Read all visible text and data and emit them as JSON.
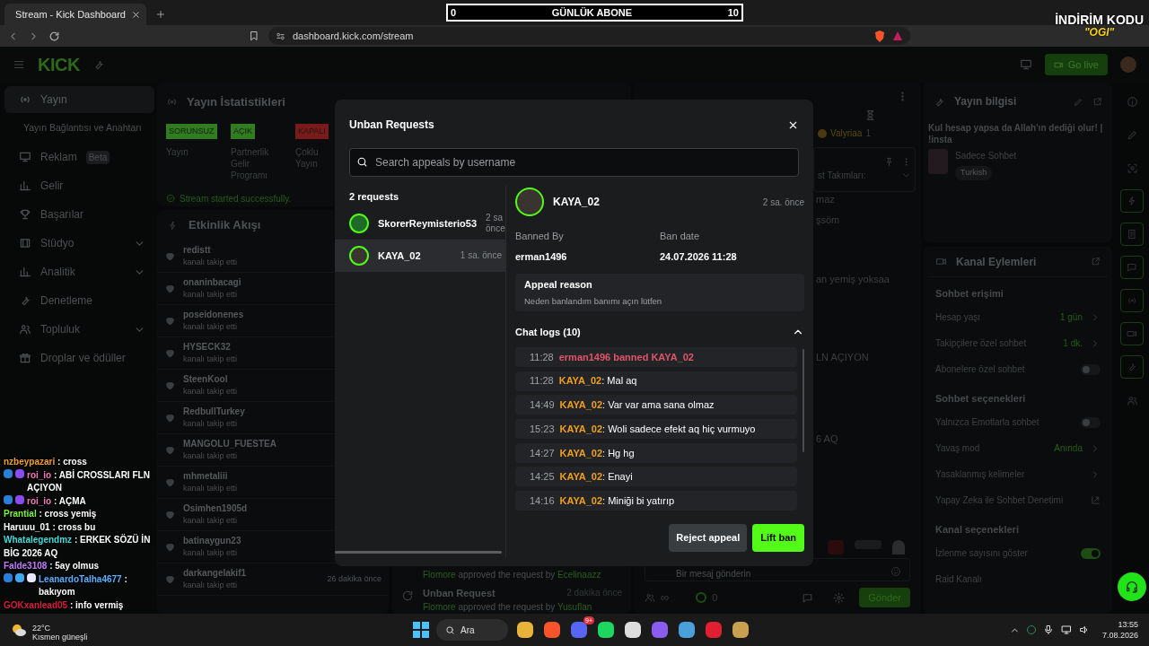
{
  "browser": {
    "tab_title": "Stream - Kick Dashboard",
    "url": "dashboard.kick.com/stream"
  },
  "stream_overlays": {
    "goal": {
      "start": "0",
      "label": "GÜNLÜK ABONE",
      "end": "10"
    },
    "promo": {
      "title": "İNDİRİM KODU",
      "code": "\"OGI\""
    }
  },
  "header": {
    "logo": "KICK",
    "go_live": "Go live"
  },
  "sidebar": {
    "items": [
      {
        "kind": "main",
        "label": "Yayın",
        "selected": true,
        "expandable": false
      },
      {
        "kind": "sub",
        "label": "Yayın Bağlantısı ve Anahtarı",
        "selected": false
      },
      {
        "kind": "main",
        "label": "Reklam",
        "badge": "Beta",
        "selected": false,
        "expandable": false
      },
      {
        "kind": "main",
        "label": "Gelir",
        "selected": false,
        "expandable": false
      },
      {
        "kind": "main",
        "label": "Başarılar",
        "selected": false,
        "expandable": false
      },
      {
        "kind": "main",
        "label": "Stüdyo",
        "selected": false,
        "expandable": true
      },
      {
        "kind": "main",
        "label": "Analitik",
        "selected": false,
        "expandable": true
      },
      {
        "kind": "main",
        "label": "Denetleme",
        "selected": false,
        "expandable": false
      },
      {
        "kind": "main",
        "label": "Topluluk",
        "selected": false,
        "expandable": true
      },
      {
        "kind": "main",
        "label": "Droplar ve ödüller",
        "selected": false,
        "expandable": false
      }
    ]
  },
  "stats": {
    "title": "Yayın İstatistikleri",
    "items": [
      {
        "badge": "SORUNSUZ",
        "color": "#2f7d1f",
        "label": "Yayın"
      },
      {
        "badge": "AÇIK",
        "color": "#2f7d1f",
        "label": "Partnerlik Gelir Programı"
      },
      {
        "badge": "KAPALI",
        "color": "#7a1a1a",
        "label": "Çoklu Yayın"
      }
    ],
    "notice": "Stream started successfully."
  },
  "feed": {
    "title": "Etkinlik Akışı",
    "events": [
      {
        "user": "redistt",
        "action": "kanalı takip etti"
      },
      {
        "user": "onaninbacagi",
        "action": "kanalı takip etti"
      },
      {
        "user": "poseidonenes",
        "action": "kanalı takip etti"
      },
      {
        "user": "HYSECK32",
        "action": "kanalı takip etti"
      },
      {
        "user": "SteenKool",
        "action": "kanalı takip etti"
      },
      {
        "user": "RedbullTurkey",
        "action": "kanalı takip etti"
      },
      {
        "user": "MANGOLU_FUESTEA",
        "action": "kanalı takip etti"
      },
      {
        "user": "mhmetaliii",
        "action": "kanalı takip etti"
      },
      {
        "user": "Osimhen1905d",
        "action": "kanalı takip etti"
      },
      {
        "user": "batinaygun23",
        "action": "kanalı takip etti"
      },
      {
        "user": "darkangelakif1",
        "action": "kanalı takip etti",
        "time": "26 dakika önce"
      }
    ]
  },
  "mod_log": {
    "entries": [
      {
        "actor": "Flomore",
        "action": "approved the request by",
        "target": "Ecelinaazz"
      },
      {
        "title": "Unban Request",
        "time": "2 dakika önce",
        "actor": "Flomore",
        "action": "approved the request by",
        "target": "Yusuflan"
      }
    ]
  },
  "chat": {
    "badged_user": "Valyriaa",
    "badged_user_count": "1",
    "pinned": "st Takımları:",
    "fragments": [
      "maz",
      "şsöm",
      "an yemiş yoksaa",
      "LN AÇIYON",
      "6 AQ"
    ],
    "input": {
      "placeholder": "Bir mesaj gönderin"
    },
    "infinity": "∞",
    "coins": "0",
    "send": "Gönder"
  },
  "stream_info": {
    "title": "Yayın bilgisi",
    "stream_title": "Kul hesap yapsa da Allah'ın dediği olur! | !insta",
    "category": "Sadece Sohbet",
    "tag": "Turkish"
  },
  "channel_actions": {
    "title": "Kanal Eylemleri",
    "rows": [
      {
        "kind": "section",
        "label": "Sohbet erişimi"
      },
      {
        "kind": "value",
        "label": "Hesap yaşı",
        "value": "1 gün"
      },
      {
        "kind": "value",
        "label": "Takipçilere özel sohbet",
        "value": "1 dk."
      },
      {
        "kind": "toggle",
        "label": "Abonelere özel sohbet",
        "on": false
      },
      {
        "kind": "section",
        "label": "Sohbet seçenekleri"
      },
      {
        "kind": "toggle",
        "label": "Yalnızca Emotlarla sohbet",
        "on": false
      },
      {
        "kind": "value",
        "label": "Yavaş mod",
        "value": "Anında"
      },
      {
        "kind": "link",
        "label": "Yasaklanmış kelimeler"
      },
      {
        "kind": "external",
        "label": "Yapay Zeka ile Sohbet Denetimi"
      },
      {
        "kind": "section",
        "label": "Kanal seçenekleri"
      },
      {
        "kind": "toggle",
        "label": "İzlenme sayısını göster",
        "on": true
      },
      {
        "kind": "plain",
        "label": "Raid Kanalı"
      }
    ]
  },
  "overlay_chat": [
    {
      "kind": "plain",
      "user": "nzbeypazari",
      "color": "#f0a030",
      "text": ": cross"
    },
    {
      "kind": "two_badges",
      "user": "roi_io",
      "color": "#f07ab8",
      "text": ": ABİ CROSSLARI FLN AÇIYON"
    },
    {
      "kind": "two_badges",
      "user": "roi_io",
      "color": "#f07ab8",
      "text": ": AÇMA"
    },
    {
      "kind": "plain",
      "user": "Prantial",
      "color": "#7cf040",
      "text": ": cross yemiş"
    },
    {
      "kind": "plain",
      "user": "Haruuu_01",
      "color": "#ffffff",
      "text": ": cross bu"
    },
    {
      "kind": "plain",
      "user": "Whatalegendmz",
      "color": "#40dcdc",
      "text": ": ERKEK SÖZÜ İN BİG 2026 AQ"
    },
    {
      "kind": "plain",
      "user": "Falde3108",
      "color": "#c07cf8",
      "text": ": 5ay olmus"
    },
    {
      "kind": "three_badges",
      "user": "LeanardoTalha4677",
      "color": "#5ab0ff",
      "text": ": bakıyom"
    },
    {
      "kind": "plain",
      "user": "GOKxanlead05",
      "color": "#d81e3c",
      "text": ": info vermiş"
    }
  ],
  "modal": {
    "title": "Unban Requests",
    "search": {
      "placeholder": "Search appeals by username"
    },
    "count": "2 requests",
    "requests": [
      {
        "user": "SkorerReymisterio53",
        "time": "2 sa önce",
        "selected": false
      },
      {
        "user": "KAYA_02",
        "time": "1 sa. önce",
        "selected": true
      }
    ],
    "detail": {
      "user": "KAYA_02",
      "time": "2 sa. önce",
      "banned_by_label": "Banned By",
      "banned_by": "erman1496",
      "ban_date_label": "Ban date",
      "ban_date": "24.07.2026 11:28",
      "reason_label": "Appeal reason",
      "reason": "Neden banlandım banımı açın lütfen",
      "logs_title": "Chat logs (10)",
      "logs_expanded": true,
      "logs": [
        {
          "kind": "ban",
          "time": "11:28",
          "text": "erman1496 banned KAYA_02"
        },
        {
          "kind": "message",
          "time": "11:28",
          "user": "KAYA_02",
          "text": ": Mal aq"
        },
        {
          "kind": "message",
          "time": "14:49",
          "user": "KAYA_02",
          "text": ": Var var ama sana olmaz"
        },
        {
          "kind": "message",
          "time": "15:23",
          "user": "KAYA_02",
          "text": ": Woli sadece efekt aq hiç vurmuyo"
        },
        {
          "kind": "message",
          "time": "14:27",
          "user": "KAYA_02",
          "text": ": Hg hg"
        },
        {
          "kind": "message",
          "time": "14:25",
          "user": "KAYA_02",
          "text": ": Enayi"
        },
        {
          "kind": "message",
          "time": "14:16",
          "user": "KAYA_02",
          "text": ": Miniği bi yatırıp"
        }
      ]
    },
    "buttons": {
      "reject": "Reject appeal",
      "lift": "Lift ban"
    }
  },
  "taskbar": {
    "weather": {
      "temp": "22°C",
      "desc": "Kısmen güneşli"
    },
    "search": "Ara",
    "app_badge": "9+",
    "clock": {
      "time": "13:55",
      "date": "7.08.2026"
    }
  }
}
